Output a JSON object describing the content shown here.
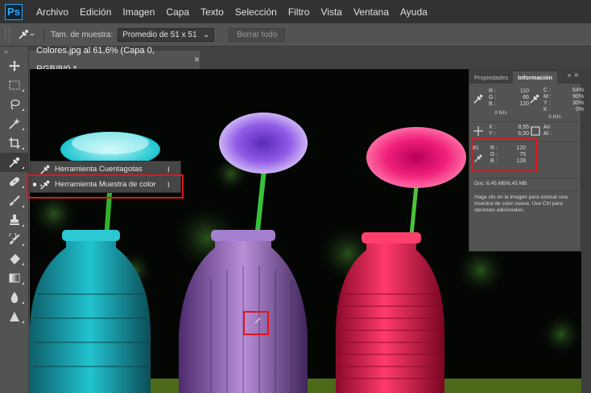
{
  "app": {
    "logo": "Ps"
  },
  "menu": [
    "Archivo",
    "Edición",
    "Imagen",
    "Capa",
    "Texto",
    "Selección",
    "Filtro",
    "Vista",
    "Ventana",
    "Ayuda"
  ],
  "options": {
    "sample_size_label": "Tam. de muestra:",
    "sample_size_value": "Promedio de 51 x 51",
    "clear_button": "Borrar todo"
  },
  "toolbar": {
    "collapse": "»",
    "tools": [
      "move-icon",
      "marquee-icon",
      "lasso-icon",
      "magic-wand-icon",
      "crop-icon",
      "eyedropper-icon",
      "spot-healing-icon",
      "brush-icon",
      "clone-stamp-icon",
      "history-brush-icon",
      "eraser-icon",
      "gradient-icon",
      "blur-icon",
      "dodge-icon"
    ]
  },
  "document": {
    "tab_title": "Colores.jpg al 61,6% (Capa 0, RGB/8#) *",
    "close": "×"
  },
  "flyout": {
    "items": [
      {
        "label": "Herramienta Cuentagotas",
        "shortcut": "I",
        "bullet": ""
      },
      {
        "label": "Herramienta Muestra de color",
        "shortcut": "I",
        "bullet": "■"
      }
    ]
  },
  "panel": {
    "tabs": [
      "Propiedades",
      "Información"
    ],
    "menu_icons": "»",
    "rgb": {
      "R": "110",
      "G": "66",
      "B": "120"
    },
    "cmyk": {
      "C": "64%",
      "M": "90%",
      "Y": "30%",
      "K": "0%"
    },
    "bits_left": "8 bits",
    "bits_right": "8 bits",
    "xy": {
      "X": "8,55",
      "Y": "6,50"
    },
    "wh": {
      "An": "",
      "Al": ""
    },
    "sampler_label": "#1",
    "sampler": {
      "R": "120",
      "G": "75",
      "B": "128"
    },
    "doc": "Doc: 6,45 MB/6,45 MB",
    "help": "Haga clic en la imagen para colocar una muestra de color nueva. Use Ctrl para opciones adicionales."
  }
}
